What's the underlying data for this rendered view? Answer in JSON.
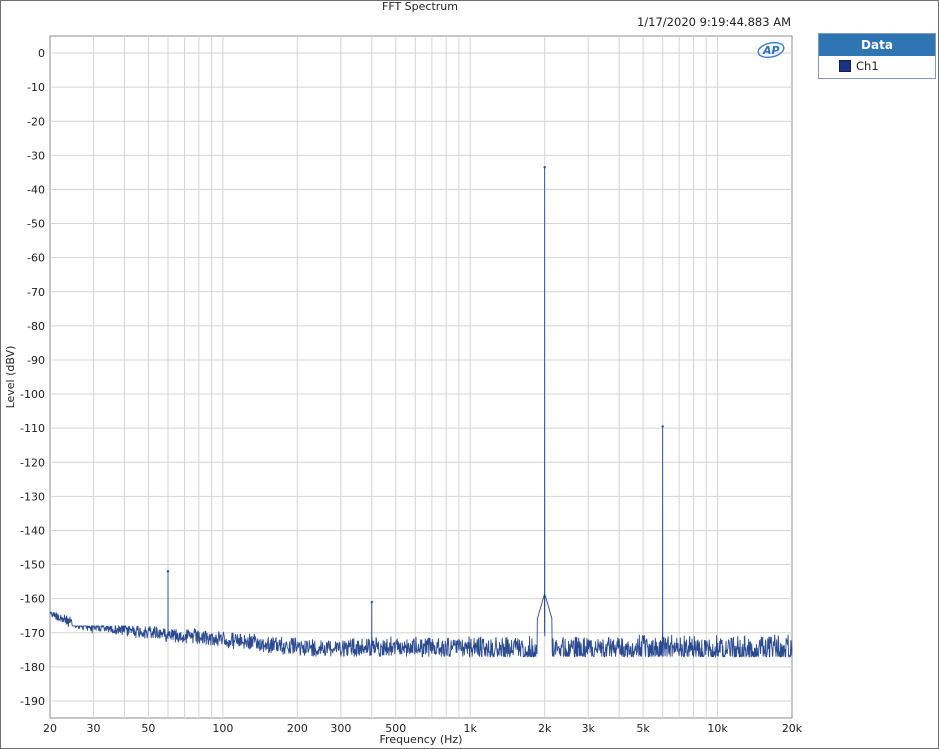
{
  "chart_data": {
    "type": "line",
    "title": "FFT Spectrum",
    "timestamp": "1/17/2020 9:19:44.883 AM",
    "xlabel": "Frequency (Hz)",
    "ylabel": "Level (dBV)",
    "x_scale": "log",
    "xlim": [
      20,
      20000
    ],
    "ylim": [
      -195,
      5
    ],
    "grid": true,
    "legend_position": "right",
    "x_ticks": [
      {
        "v": 20,
        "label": "20"
      },
      {
        "v": 30,
        "label": "30"
      },
      {
        "v": 50,
        "label": "50"
      },
      {
        "v": 100,
        "label": "100"
      },
      {
        "v": 200,
        "label": "200"
      },
      {
        "v": 300,
        "label": "300"
      },
      {
        "v": 500,
        "label": "500"
      },
      {
        "v": 1000,
        "label": "1k"
      },
      {
        "v": 2000,
        "label": "2k"
      },
      {
        "v": 3000,
        "label": "3k"
      },
      {
        "v": 5000,
        "label": "5k"
      },
      {
        "v": 10000,
        "label": "10k"
      },
      {
        "v": 20000,
        "label": "20k"
      }
    ],
    "y_ticks": [
      0,
      -10,
      -20,
      -30,
      -40,
      -50,
      -60,
      -70,
      -80,
      -90,
      -100,
      -110,
      -120,
      -130,
      -140,
      -150,
      -160,
      -170,
      -180,
      -190
    ],
    "noise_floor": {
      "from_db": -166,
      "to_db": -173,
      "min_db": -177,
      "max_db": -168
    },
    "series": [
      {
        "name": "Ch1",
        "color": "#2b4a8f",
        "peaks": [
          {
            "x": 60,
            "y": -152
          },
          {
            "x": 400,
            "y": -161
          },
          {
            "x": 2000,
            "y": -33.5
          },
          {
            "x": 6000,
            "y": -109.5
          }
        ]
      }
    ]
  },
  "legend": {
    "header": "Data",
    "items": [
      {
        "label": "Ch1",
        "color": "#1c3480"
      }
    ]
  },
  "icons": {
    "logo": "ap-logo-icon"
  }
}
